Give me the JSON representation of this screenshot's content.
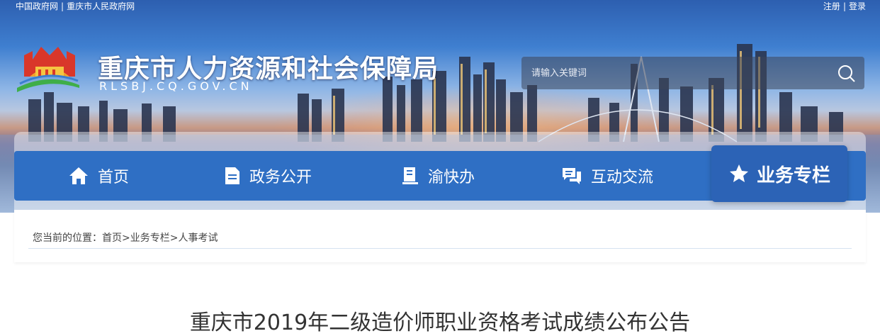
{
  "topbar": {
    "links_left": [
      "中国政府网",
      "重庆市人民政府网"
    ],
    "separator": "|",
    "links_right": [
      "注册",
      "登录"
    ]
  },
  "site": {
    "title": "重庆市人力资源和社会保障局",
    "domain": "RLSBJ.CQ.GOV.CN"
  },
  "search": {
    "placeholder": "请输入关键词",
    "icon": "search-icon"
  },
  "nav": {
    "items": [
      {
        "label": "首页",
        "icon": "home-icon"
      },
      {
        "label": "政务公开",
        "icon": "document-icon"
      },
      {
        "label": "渝快办",
        "icon": "book-icon"
      },
      {
        "label": "互动交流",
        "icon": "chat-icon"
      }
    ],
    "active": {
      "label": "业务专栏",
      "icon": "star-icon"
    }
  },
  "breadcrumb": {
    "prefix": "您当前的位置：",
    "items": [
      "首页",
      "业务专栏",
      "人事考试"
    ],
    "separator": ">"
  },
  "article": {
    "title": "重庆市2019年二级造价师职业资格考试成绩公布公告"
  },
  "colors": {
    "nav_bg": "#2f6fc4",
    "nav_active_bg": "#2c63b6",
    "text": "#333333"
  }
}
